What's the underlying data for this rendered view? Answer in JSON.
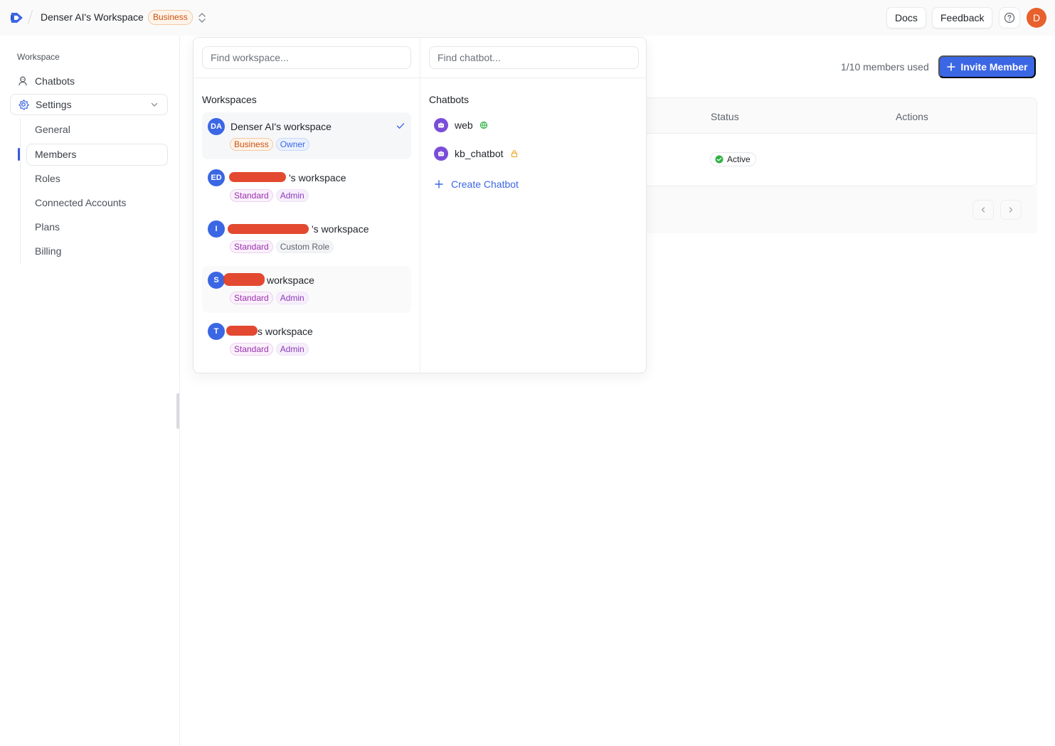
{
  "header": {
    "workspace_title": "Denser AI's Workspace",
    "plan_badge": "Business",
    "docs_label": "Docs",
    "feedback_label": "Feedback",
    "avatar_initial": "D",
    "icons": {
      "logo": "denser-logo-icon",
      "switch": "chevrons-up-down-icon",
      "help": "help-circle-icon"
    }
  },
  "sidebar": {
    "section_label": "Workspace",
    "items": [
      {
        "label": "Chatbots",
        "icon": "bot-icon"
      },
      {
        "label": "Settings",
        "icon": "gear-icon",
        "expanded": true
      }
    ],
    "settings_subitems": [
      {
        "label": "General"
      },
      {
        "label": "Members",
        "active": true
      },
      {
        "label": "Roles"
      },
      {
        "label": "Connected Accounts"
      },
      {
        "label": "Plans"
      },
      {
        "label": "Billing"
      }
    ]
  },
  "main": {
    "members_used": "1/10 members used",
    "invite_label": "Invite Member",
    "table": {
      "headers": {
        "status": "Status",
        "actions": "Actions"
      },
      "rows": [
        {
          "status": "Active"
        }
      ]
    }
  },
  "popover": {
    "workspace_search_placeholder": "Find workspace...",
    "chatbot_search_placeholder": "Find chatbot...",
    "workspaces_heading": "Workspaces",
    "chatbots_heading": "Chatbots",
    "workspaces": [
      {
        "initials": "DA",
        "name": "Denser AI's workspace",
        "tags": [
          "Business",
          "Owner"
        ],
        "selected": true
      },
      {
        "initials": "ED",
        "name": "'s workspace",
        "tags": [
          "Standard",
          "Admin"
        ]
      },
      {
        "initials": "I",
        "name": "'s workspace",
        "tags": [
          "Standard",
          "Custom Role"
        ]
      },
      {
        "initials": "S",
        "name": "workspace",
        "tags": [
          "Standard",
          "Admin"
        ]
      },
      {
        "initials": "T",
        "name": "s workspace",
        "tags": [
          "Standard",
          "Admin"
        ]
      }
    ],
    "chatbots": [
      {
        "name": "web",
        "status_icon": "globe-icon"
      },
      {
        "name": "kb_chatbot",
        "status_icon": "lock-icon"
      }
    ],
    "create_chatbot_label": "Create Chatbot"
  },
  "colors": {
    "accent": "#3b66e4",
    "avatar": "#e8602c",
    "active_green": "#2fb344"
  }
}
